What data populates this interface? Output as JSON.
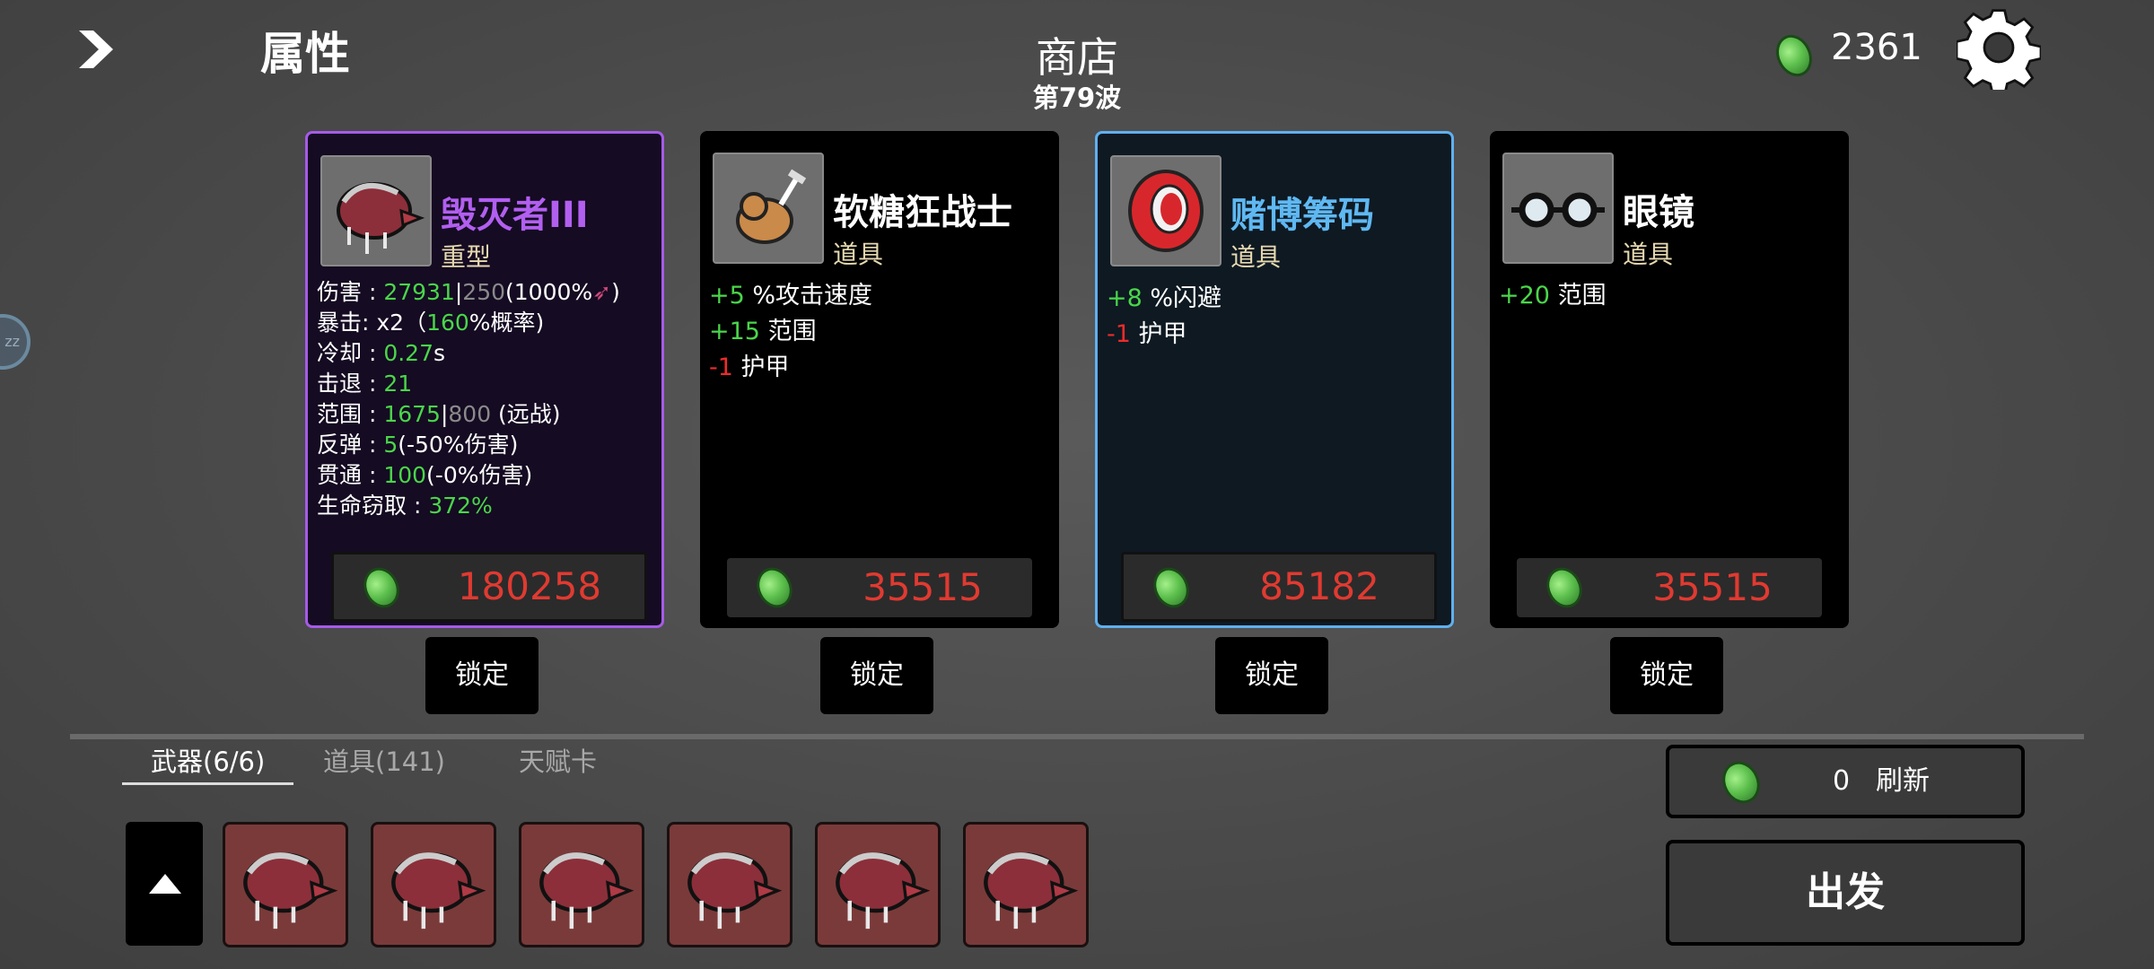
{
  "header": {
    "attributes_label": "属性",
    "shop_title": "商店",
    "wave": "第79波",
    "gold": "2361"
  },
  "cards": [
    {
      "name": "毁灭者III",
      "type": "重型",
      "name_color": "#b25ff0",
      "stats": {
        "damage_label": "伤害 : ",
        "damage_value": "27931",
        "damage_sep": "|",
        "damage_base": "250",
        "damage_scale": "(1000%",
        "damage_end": ")",
        "crit_label": "暴击:  x2（",
        "crit_value": "160",
        "crit_suffix": "%概率)",
        "cooldown_label": "冷却 : ",
        "cooldown_value": "0.27",
        "cooldown_unit": "s",
        "knockback_label": "击退 : ",
        "knockback_value": "21",
        "range_label": "范围 : ",
        "range_value": "1675",
        "range_sep": "|",
        "range_base": "800",
        "range_suffix": " (远战)",
        "bounce_label": "反弹 : ",
        "bounce_value": "5",
        "bounce_suffix": "(-50%伤害)",
        "pierce_label": "贯通 : ",
        "pierce_value": "100",
        "pierce_suffix": "(-0%伤害)",
        "lifesteal_label": "生命窃取 : ",
        "lifesteal_value": "372%"
      },
      "price": "180258",
      "lock_label": "锁定"
    },
    {
      "name": "软糖狂战士",
      "type": "道具",
      "name_color": "#ffffff",
      "effects": [
        {
          "value": "+5",
          "text": " %攻击速度",
          "color": "#4ad64a"
        },
        {
          "value": "+15",
          "text": " 范围",
          "color": "#4ad64a"
        },
        {
          "value": "-1",
          "text": " 护甲",
          "color": "#ee2b2b"
        }
      ],
      "price": "35515",
      "lock_label": "锁定"
    },
    {
      "name": "赌博筹码",
      "type": "道具",
      "name_color": "#5fb8f2",
      "effects": [
        {
          "value": "+8",
          "text": " %闪避",
          "color": "#4ad64a"
        },
        {
          "value": "-1",
          "text": " 护甲",
          "color": "#ee2b2b"
        }
      ],
      "price": "85182",
      "lock_label": "锁定"
    },
    {
      "name": "眼镜",
      "type": "道具",
      "name_color": "#ffffff",
      "effects": [
        {
          "value": "+20",
          "text": " 范围",
          "color": "#4ad64a"
        }
      ],
      "price": "35515",
      "lock_label": "锁定"
    }
  ],
  "tabs": [
    {
      "label": "武器(6/6)",
      "active": true
    },
    {
      "label": "道具(141)",
      "active": false
    },
    {
      "label": "天赋卡",
      "active": false
    }
  ],
  "inventory": {
    "weapon_icon": "destroyer-weapon-icon",
    "count": 6
  },
  "refresh": {
    "cost": "0",
    "label": "刷新"
  },
  "go_label": "出发",
  "side_bubble": "zz"
}
